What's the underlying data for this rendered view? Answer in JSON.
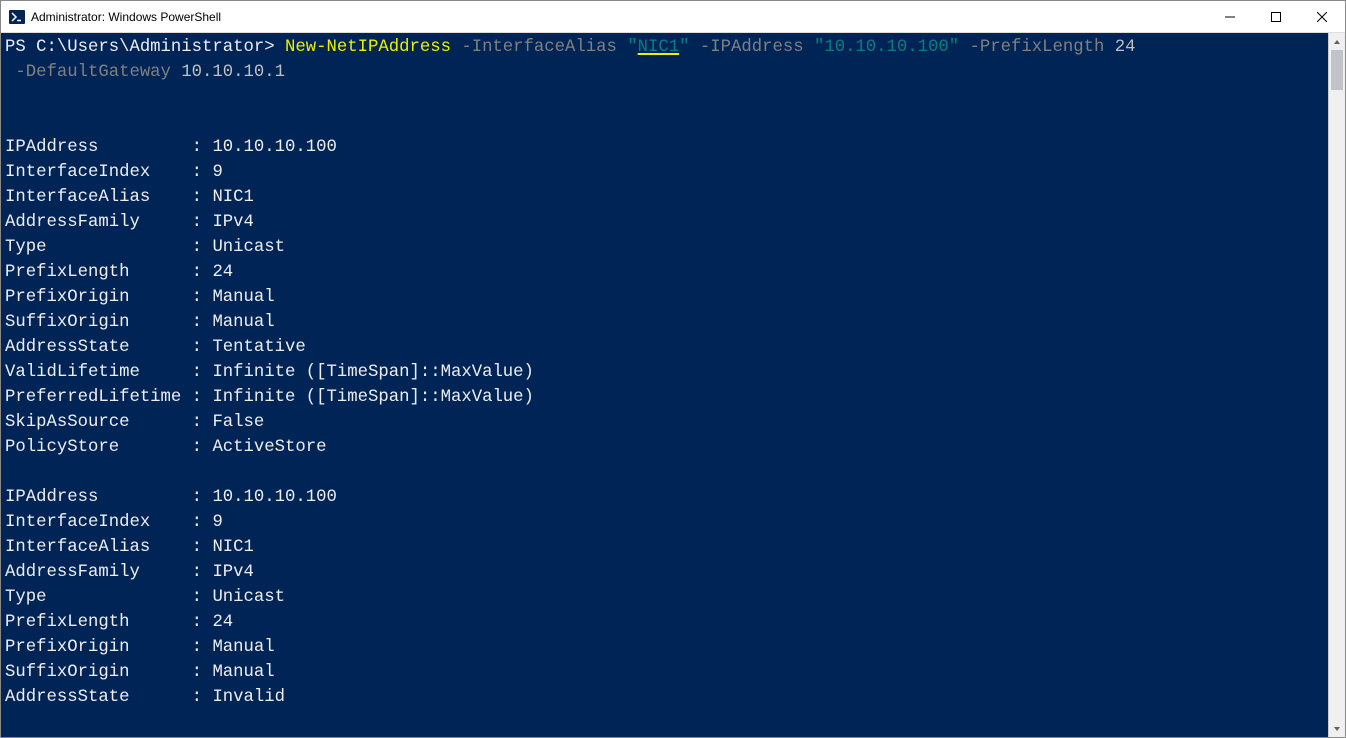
{
  "window": {
    "title": "Administrator: Windows PowerShell"
  },
  "prompt": {
    "prefix": "PS C:\\Users\\Administrator> ",
    "cmdlet": "New-NetIPAddress",
    "param1_name": " -InterfaceAlias ",
    "param1_q1": "\"",
    "param1_val": "NIC1",
    "param1_q2": "\"",
    "param2_name": " -IPAddress ",
    "param2_val": "\"10.10.10.100\"",
    "param3_name": " -PrefixLength ",
    "param3_val": "24",
    "param4_name": " -DefaultGateway ",
    "param4_val": "10.10.10.1"
  },
  "block1": {
    "r0k": "IPAddress",
    "r0v": "10.10.10.100",
    "r1k": "InterfaceIndex",
    "r1v": "9",
    "r2k": "InterfaceAlias",
    "r2v": "NIC1",
    "r3k": "AddressFamily",
    "r3v": "IPv4",
    "r4k": "Type",
    "r4v": "Unicast",
    "r5k": "PrefixLength",
    "r5v": "24",
    "r6k": "PrefixOrigin",
    "r6v": "Manual",
    "r7k": "SuffixOrigin",
    "r7v": "Manual",
    "r8k": "AddressState",
    "r8v": "Tentative",
    "r9k": "ValidLifetime",
    "r9v": "Infinite ([TimeSpan]::MaxValue)",
    "r10k": "PreferredLifetime",
    "r10v": "Infinite ([TimeSpan]::MaxValue)",
    "r11k": "SkipAsSource",
    "r11v": "False",
    "r12k": "PolicyStore",
    "r12v": "ActiveStore"
  },
  "block2": {
    "r0k": "IPAddress",
    "r0v": "10.10.10.100",
    "r1k": "InterfaceIndex",
    "r1v": "9",
    "r2k": "InterfaceAlias",
    "r2v": "NIC1",
    "r3k": "AddressFamily",
    "r3v": "IPv4",
    "r4k": "Type",
    "r4v": "Unicast",
    "r5k": "PrefixLength",
    "r5v": "24",
    "r6k": "PrefixOrigin",
    "r6v": "Manual",
    "r7k": "SuffixOrigin",
    "r7v": "Manual",
    "r8k": "AddressState",
    "r8v": "Invalid"
  }
}
